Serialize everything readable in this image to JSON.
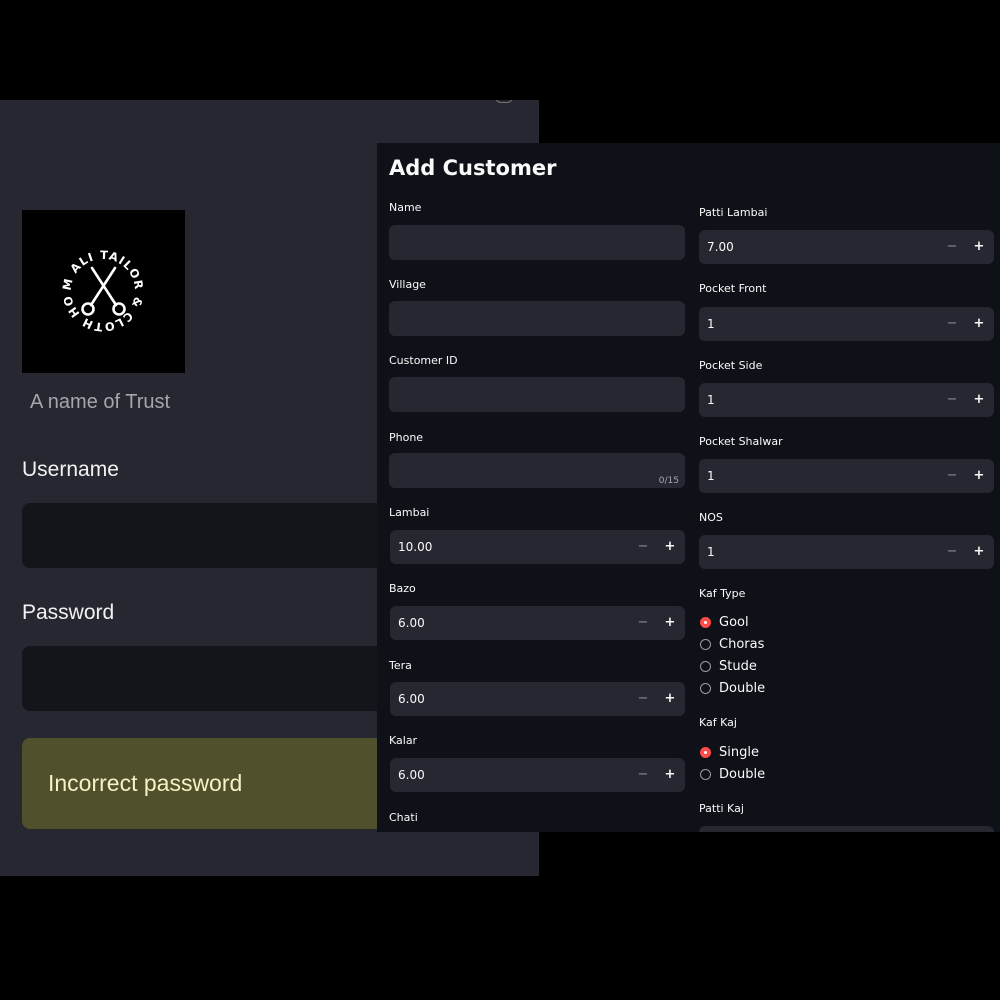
{
  "login": {
    "logo_text": "M ALI TAILOR & CLOTH HOUSE",
    "tagline": "A name of Trust",
    "username_label": "Username",
    "username_value": "",
    "password_label": "Password",
    "password_value": "",
    "alert_text": "Incorrect password",
    "alert_color": "#50502d"
  },
  "form": {
    "title": "Add Customer",
    "accent_color": "#ff4b4b",
    "text_fields": [
      {
        "label": "Name",
        "value": ""
      },
      {
        "label": "Village",
        "value": ""
      },
      {
        "label": "Customer ID",
        "value": ""
      },
      {
        "label": "Phone",
        "value": "",
        "counter": "0/15"
      }
    ],
    "left_numbers": [
      {
        "label": "Lambai",
        "value": "10.00"
      },
      {
        "label": "Bazo",
        "value": "6.00"
      },
      {
        "label": "Tera",
        "value": "6.00"
      },
      {
        "label": "Kalar",
        "value": "6.00"
      }
    ],
    "chati_label": "Chati",
    "right_numbers": [
      {
        "label": "Patti Lambai",
        "value": "7.00"
      },
      {
        "label": "Pocket Front",
        "value": "1"
      },
      {
        "label": "Pocket Side",
        "value": "1"
      },
      {
        "label": "Pocket Shalwar",
        "value": "1"
      },
      {
        "label": "NOS",
        "value": "1"
      }
    ],
    "minus_symbol": "−",
    "plus_symbol": "+",
    "kaf_type": {
      "label": "Kaf Type",
      "options": [
        "Gool",
        "Choras",
        "Stude",
        "Double"
      ],
      "selected": "Gool"
    },
    "kaf_kaj": {
      "label": "Kaf Kaj",
      "options": [
        "Single",
        "Double"
      ],
      "selected": "Single"
    },
    "patti_kaj_label": "Patti Kaj"
  }
}
